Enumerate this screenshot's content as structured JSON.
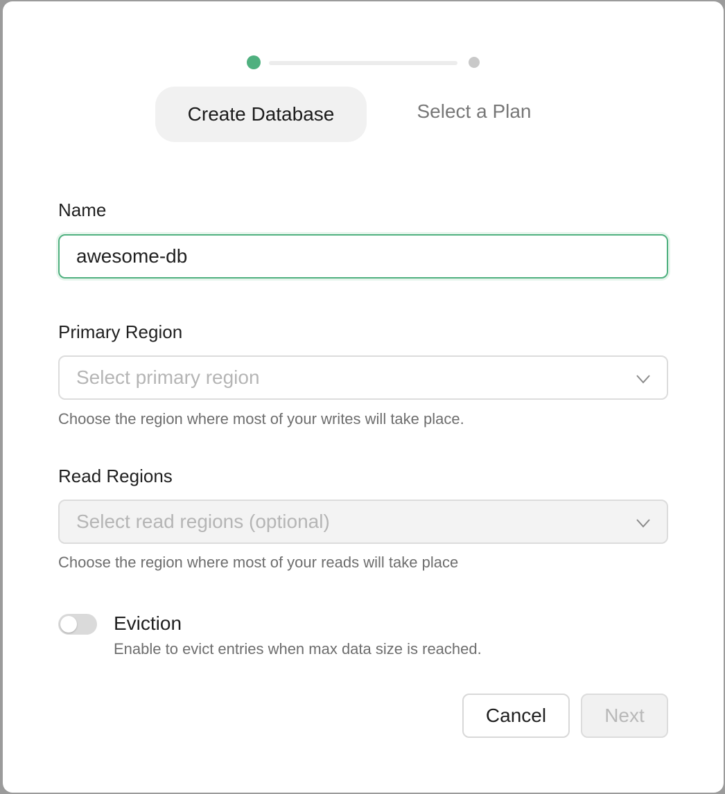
{
  "stepper": {
    "steps": [
      {
        "label": "Create Database",
        "active": true
      },
      {
        "label": "Select a Plan",
        "active": false
      }
    ],
    "active_color": "#4fb07f",
    "inactive_color": "#c9c9c9"
  },
  "form": {
    "name": {
      "label": "Name",
      "value": "awesome-db"
    },
    "primary_region": {
      "label": "Primary Region",
      "placeholder": "Select primary region",
      "help": "Choose the region where most of your writes will take place."
    },
    "read_regions": {
      "label": "Read Regions",
      "placeholder": "Select read regions (optional)",
      "help": "Choose the region where most of your reads will take place"
    },
    "eviction": {
      "label": "Eviction",
      "description": "Enable to evict entries when max data size is reached.",
      "enabled": false
    }
  },
  "actions": {
    "cancel_label": "Cancel",
    "next_label": "Next"
  },
  "icons": {
    "select_chevron": "chevron-down-icon"
  }
}
